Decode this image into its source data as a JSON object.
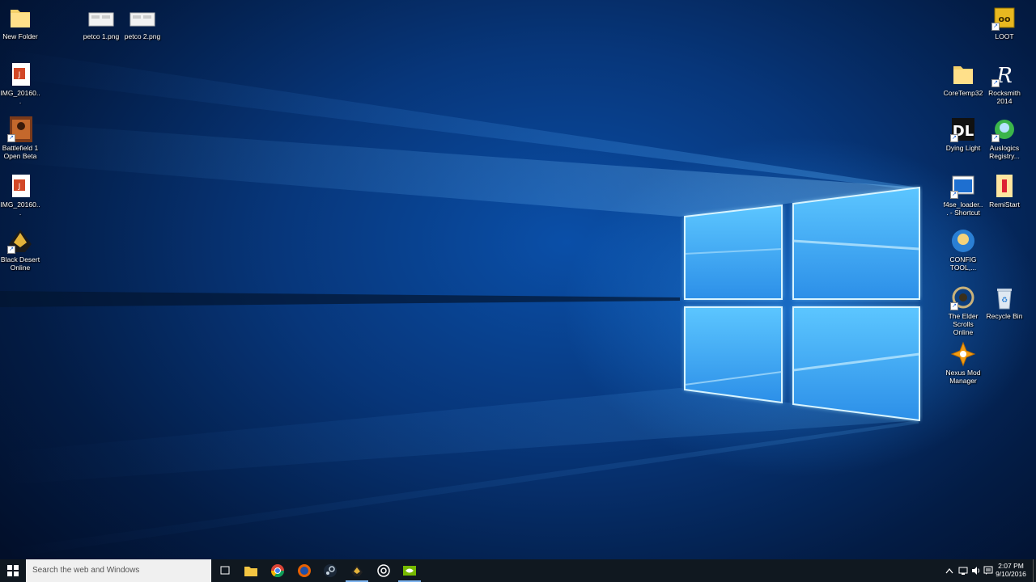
{
  "desktop_icons_left": [
    {
      "name": "new-folder-icon",
      "label": "New Folder",
      "type": "folder"
    },
    {
      "name": "img-file-icon-1",
      "label": "IMG_20160...",
      "type": "image"
    },
    {
      "name": "battlefield-icon",
      "label": "Battlefield 1 Open Beta",
      "type": "game"
    },
    {
      "name": "img-file-icon-2",
      "label": "IMG_20160...",
      "type": "image"
    },
    {
      "name": "black-desert-icon",
      "label": "Black Desert Online",
      "type": "game"
    }
  ],
  "desktop_icons_top": [
    {
      "name": "petco-1-icon",
      "label": "petco 1.png"
    },
    {
      "name": "petco-2-icon",
      "label": "petco 2.png"
    }
  ],
  "desktop_icons_right": [
    {
      "name": "loot-icon",
      "label": "LOOT"
    },
    {
      "name": "coretemp-icon",
      "label": "CoreTemp32"
    },
    {
      "name": "rocksmith-icon",
      "label": "Rocksmith 2014"
    },
    {
      "name": "dying-light-icon",
      "label": "Dying Light"
    },
    {
      "name": "auslogics-icon",
      "label": "Auslogics Registry..."
    },
    {
      "name": "f4se-icon",
      "label": "f4se_loader... - Shortcut"
    },
    {
      "name": "remistart-icon",
      "label": "RemiStart"
    },
    {
      "name": "config-tool-icon",
      "label": "CONFIG TOOL,..."
    },
    {
      "name": "elder-scrolls-icon",
      "label": "The Elder Scrolls Online"
    },
    {
      "name": "recycle-bin-icon",
      "label": "Recycle Bin"
    },
    {
      "name": "nexus-mod-icon",
      "label": "Nexus Mod Manager"
    }
  ],
  "taskbar": {
    "search_placeholder": "Search the web and Windows",
    "clock_time": "2:07 PM",
    "clock_date": "9/10/2016"
  },
  "colors": {
    "accent": "#7db4f0",
    "taskbar": "#101820",
    "logo": "#45b6ff"
  }
}
